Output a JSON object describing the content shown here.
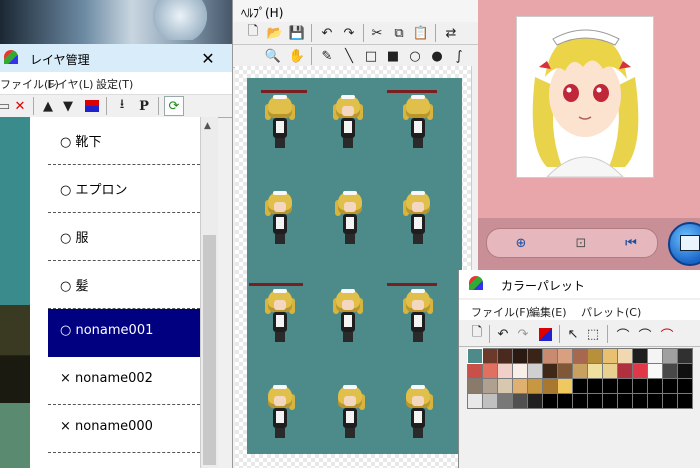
{
  "layer_window": {
    "title": "レイヤ管理",
    "menu": [
      "ファイル(F)",
      "レイヤ(L)",
      "設定(T)"
    ],
    "toolbar_icons": [
      "new-layer-icon",
      "delete-layer-icon",
      "move-up-icon",
      "move-down-icon",
      "merge-icon",
      "import-icon",
      "property-icon",
      "refresh-icon"
    ],
    "layers": [
      {
        "mark": "○",
        "name": "靴下",
        "selected": false
      },
      {
        "mark": "○",
        "name": "エプロン",
        "selected": false
      },
      {
        "mark": "○",
        "name": "服",
        "selected": false
      },
      {
        "mark": "○",
        "name": "髪",
        "selected": false
      },
      {
        "mark": "○",
        "name": "noname001",
        "selected": true
      },
      {
        "mark": "×",
        "name": "noname002",
        "selected": false
      },
      {
        "mark": "×",
        "name": "noname000",
        "selected": false
      }
    ]
  },
  "editor": {
    "menu_fragment": "ﾍﾙﾌﾟ(H)",
    "toolbar1": [
      "new-icon",
      "open-icon",
      "save-icon",
      "undo-icon",
      "redo-icon",
      "cut-icon",
      "copy-icon",
      "paste-icon",
      "swap-icon"
    ],
    "toolbar2": [
      "zoom-icon",
      "hand-icon",
      "pen-icon",
      "line-icon",
      "rect-icon",
      "fill-rect-icon",
      "circle-icon",
      "fill-circle-icon",
      "curve-icon"
    ]
  },
  "palette_window": {
    "title": "カラーパレット",
    "menu": [
      "ファイル(F)",
      "編集(E)",
      "パレット(C)"
    ],
    "colors": [
      "#4d8b8b",
      "#6b3a2a",
      "#4a2a1e",
      "#2a1a12",
      "#3a2418",
      "#c88a70",
      "#d8a080",
      "#a86850",
      "#b8903a",
      "#e8c070",
      "#f0d8b0",
      "#1e1e1e",
      "#f4f4f4",
      "#a0a0a0",
      "#303030",
      "#c85048",
      "#e07060",
      "#f0d0c8",
      "#f8f0e8",
      "#d0d0d0",
      "#402818",
      "#805838",
      "#c8a060",
      "#f0e0a0",
      "#e8d090",
      "#b03040",
      "#e03848",
      "#f8f8f8",
      "#484848",
      "#101010",
      "#8a7a6a",
      "#b0a090",
      "#d8c8b0",
      "#e0b070",
      "#c89840",
      "#a87830",
      "#f0c860",
      "#000000",
      "#000000",
      "#000000",
      "#000000",
      "#000000",
      "#000000",
      "#000000",
      "#000000",
      "#e8e8e8",
      "#c0c0c0",
      "#787878",
      "#505050",
      "#202020",
      "#000000",
      "#000000",
      "#000000",
      "#000000",
      "#000000",
      "#000000",
      "#000000",
      "#000000",
      "#000000",
      "#000000"
    ]
  }
}
